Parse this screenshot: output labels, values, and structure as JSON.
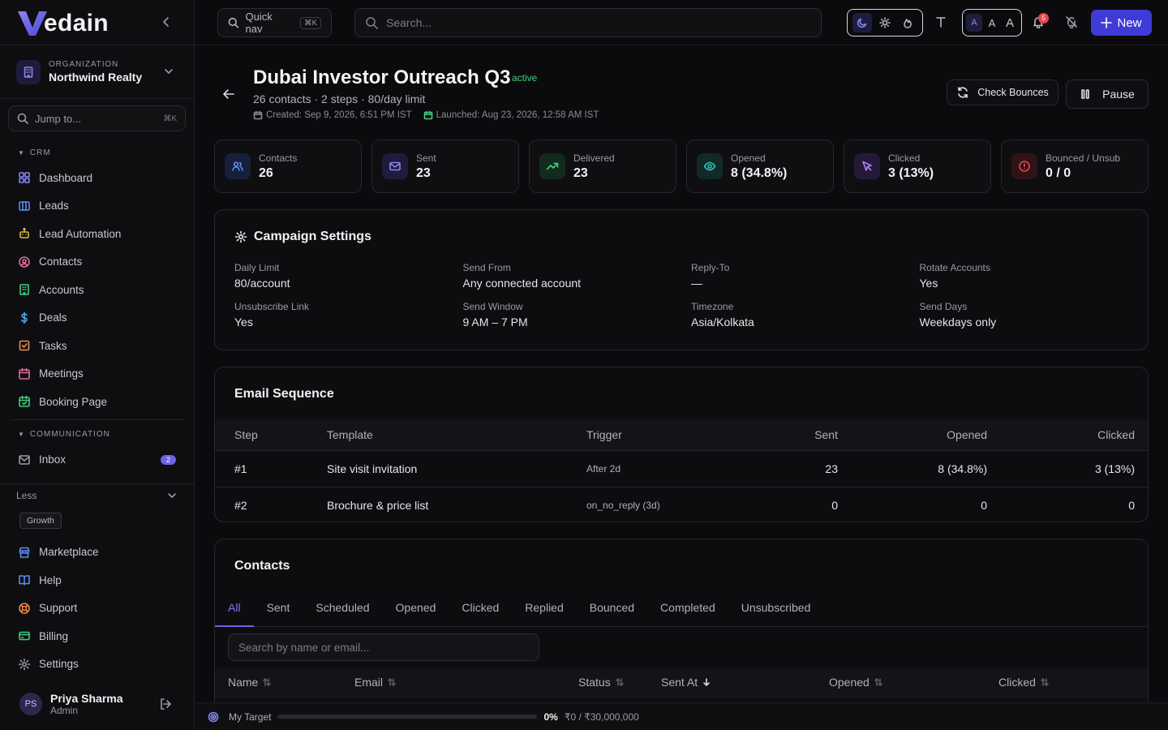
{
  "brand": {
    "logo_text": "edain"
  },
  "sidebar": {
    "org_caption": "ORGANIZATION",
    "org_name": "Northwind Realty",
    "jump_placeholder": "Jump to...",
    "jump_shortcut": "⌘K",
    "crm_heading": "CRM",
    "crm_items": [
      {
        "label": "Dashboard",
        "icon": "dashboard-icon",
        "color": "#8b85f4"
      },
      {
        "label": "Leads",
        "icon": "columns-icon",
        "color": "#5b8ef0"
      },
      {
        "label": "Lead Automation",
        "icon": "bot-icon",
        "color": "#e0b64a"
      },
      {
        "label": "Contacts",
        "icon": "user-circle-icon",
        "color": "#e06aa0"
      },
      {
        "label": "Accounts",
        "icon": "building-icon",
        "color": "#3fcf7a"
      },
      {
        "label": "Deals",
        "icon": "dollar-icon",
        "color": "#4aa8f0"
      },
      {
        "label": "Tasks",
        "icon": "task-icon",
        "color": "#f08a4a"
      },
      {
        "label": "Meetings",
        "icon": "calendar-icon",
        "color": "#e06aa0"
      },
      {
        "label": "Booking Page",
        "icon": "calendar-check-icon",
        "color": "#3fcf7a"
      }
    ],
    "comm_heading": "COMMUNICATION",
    "comm_items": [
      {
        "label": "Inbox",
        "icon": "inbox-icon",
        "color": "#9a9aa3",
        "badge": "2"
      }
    ],
    "less_label": "Less",
    "plan_badge": "Growth",
    "bottom_items": [
      {
        "label": "Marketplace",
        "icon": "store-icon",
        "color": "#5b8ef0"
      },
      {
        "label": "Help",
        "icon": "book-icon",
        "color": "#5b8ef0"
      },
      {
        "label": "Support",
        "icon": "lifebuoy-icon",
        "color": "#f08a4a"
      },
      {
        "label": "Billing",
        "icon": "card-icon",
        "color": "#3fcf7a"
      },
      {
        "label": "Settings",
        "icon": "gear-icon",
        "color": "#9a9aa3"
      }
    ],
    "user": {
      "initials": "PS",
      "name": "Priya Sharma",
      "role": "Admin"
    }
  },
  "topbar": {
    "quicknav_label": "Quick nav",
    "quicknav_shortcut": "⌘K",
    "search_placeholder": "Search...",
    "text_sizes": [
      "A",
      "A",
      "A"
    ],
    "notification_count": "5",
    "new_label": "New"
  },
  "campaign": {
    "title": "Dubai Investor Outreach Q3",
    "status": "active",
    "subtitle": "26 contacts · 2 steps · 80/day limit",
    "created": "Created: Sep 9, 2026, 6:51 PM IST",
    "launched": "Launched: Aug 23, 2026, 12:58 AM IST",
    "check_bounces_label": "Check Bounces",
    "pause_label": "Pause"
  },
  "stats": [
    {
      "label": "Contacts",
      "value": "26",
      "icon": "users-icon",
      "color": "#5b8ef0",
      "bg": "#16203a"
    },
    {
      "label": "Sent",
      "value": "23",
      "icon": "mail-icon",
      "color": "#8b85f4",
      "bg": "#1e1c3a"
    },
    {
      "label": "Delivered",
      "value": "23",
      "icon": "trending-up-icon",
      "color": "#3fcf7a",
      "bg": "#132a1e"
    },
    {
      "label": "Opened",
      "value": "8 (34.8%)",
      "icon": "eye-icon",
      "color": "#2ec4b6",
      "bg": "#102a28"
    },
    {
      "label": "Clicked",
      "value": "3 (13%)",
      "icon": "pointer-icon",
      "color": "#b07ef0",
      "bg": "#241a38"
    },
    {
      "label": "Bounced / Unsub",
      "value": "0 / 0",
      "icon": "alert-icon",
      "color": "#e5484d",
      "bg": "#2e1416"
    }
  ],
  "settings": {
    "title": "Campaign Settings",
    "fields": [
      {
        "label": "Daily Limit",
        "value": "80/account"
      },
      {
        "label": "Send From",
        "value": "Any connected account"
      },
      {
        "label": "Reply-To",
        "value": "—"
      },
      {
        "label": "Rotate Accounts",
        "value": "Yes"
      },
      {
        "label": "Unsubscribe Link",
        "value": "Yes"
      },
      {
        "label": "Send Window",
        "value": "9 AM – 7 PM"
      },
      {
        "label": "Timezone",
        "value": "Asia/Kolkata"
      },
      {
        "label": "Send Days",
        "value": "Weekdays only"
      }
    ]
  },
  "sequence": {
    "title": "Email Sequence",
    "headers": [
      "Step",
      "Template",
      "Trigger",
      "Sent",
      "Opened",
      "Clicked"
    ],
    "rows": [
      {
        "step": "#1",
        "template": "Site visit invitation",
        "trigger": "After 2d",
        "sent": "23",
        "opened": "8 (34.8%)",
        "clicked": "3 (13%)"
      },
      {
        "step": "#2",
        "template": "Brochure & price list",
        "trigger": "on_no_reply (3d)",
        "sent": "0",
        "opened": "0",
        "clicked": "0"
      }
    ]
  },
  "contacts": {
    "title": "Contacts",
    "tabs": [
      "All",
      "Sent",
      "Scheduled",
      "Opened",
      "Clicked",
      "Replied",
      "Bounced",
      "Completed",
      "Unsubscribed"
    ],
    "active_tab": "All",
    "search_placeholder": "Search by name or email...",
    "columns": [
      "Name",
      "Email",
      "Status",
      "Sent At",
      "Opened",
      "Clicked"
    ]
  },
  "target": {
    "label": "My Target",
    "progress_fraction": 0,
    "percent": "0%",
    "amount": "₹0 / ₹30,000,000"
  }
}
